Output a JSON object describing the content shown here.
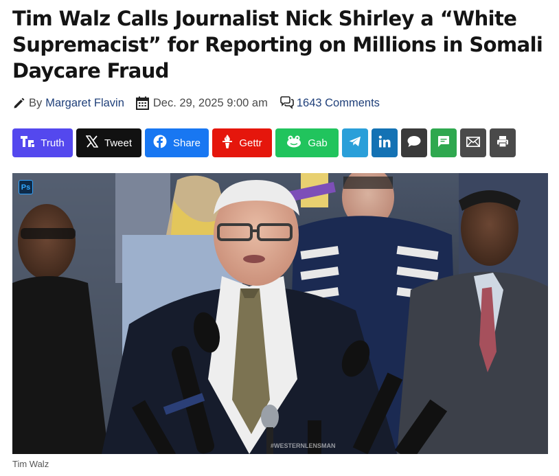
{
  "article": {
    "title": "Tim Walz Calls Journalist Nick Shirley a “White Supremacist” for Reporting on Millions in Somali Daycare Fraud",
    "byline_prefix": "By",
    "author": "Margaret Flavin",
    "date": "Dec. 29, 2025 9:00 am",
    "comments": "1643 Comments",
    "image_caption": "Tim Walz",
    "image_badge": "Ps",
    "image_watermark": "#WESTERNLENSMAN"
  },
  "share": {
    "buttons": [
      {
        "label": "Truth",
        "icon": "truth-social-icon",
        "color": "#5448ee"
      },
      {
        "label": "Tweet",
        "icon": "x-icon",
        "color": "#111111"
      },
      {
        "label": "Share",
        "icon": "facebook-icon",
        "color": "#1877f2"
      },
      {
        "label": "Gettr",
        "icon": "gettr-icon",
        "color": "#e5160c"
      },
      {
        "label": "Gab",
        "icon": "gab-icon",
        "color": "#21c45d"
      },
      {
        "label": "",
        "icon": "telegram-icon",
        "color": "#2a9fd9"
      },
      {
        "label": "",
        "icon": "linkedin-icon",
        "color": "#1472b4"
      },
      {
        "label": "",
        "icon": "comment-bubble-icon",
        "color": "#3a3a3a"
      },
      {
        "label": "",
        "icon": "sms-icon",
        "color": "#2fa84f"
      },
      {
        "label": "",
        "icon": "email-icon",
        "color": "#4a4a4a"
      },
      {
        "label": "",
        "icon": "print-icon",
        "color": "#4a4a4a"
      }
    ]
  }
}
